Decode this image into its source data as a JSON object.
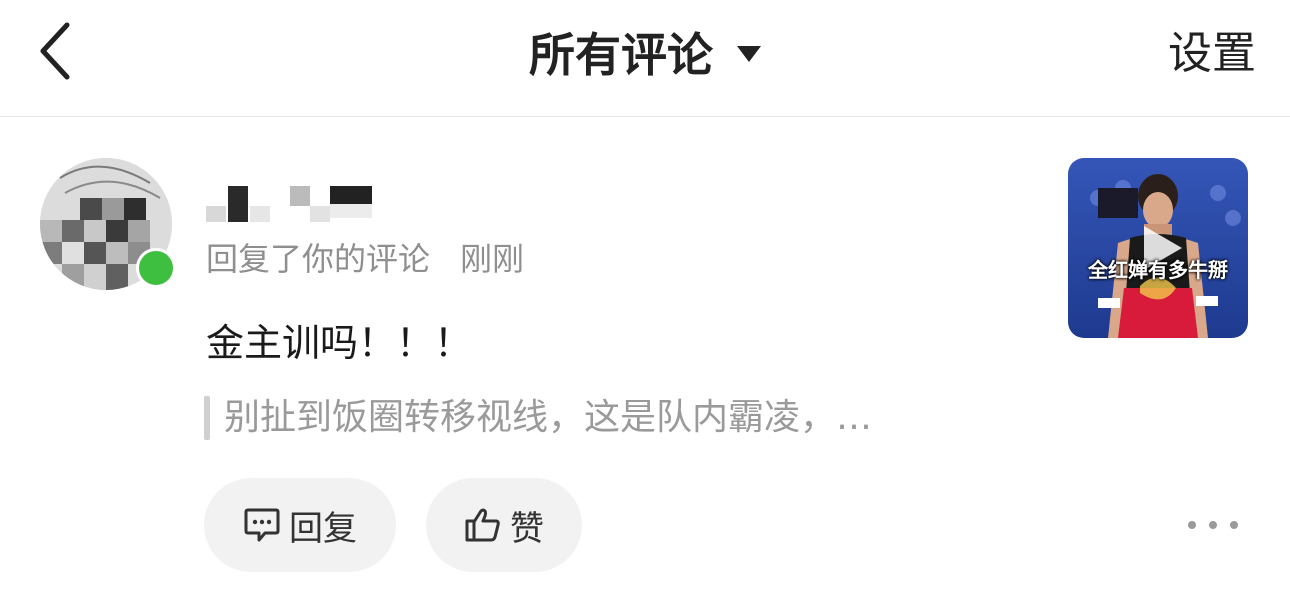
{
  "header": {
    "title": "所有评论",
    "settings_label": "设置"
  },
  "comment": {
    "action_text": "回复了你的评论",
    "time": "刚刚",
    "text": "金主训吗！！！",
    "quoted_text": "别扯到饭圈转移视线，这是队内霸凌，…",
    "thumbnail_caption": "全红婵有多牛掰",
    "reply_label": "回复",
    "like_label": "赞"
  },
  "colors": {
    "accent_green": "#3fbf3f",
    "muted_text": "#8f8f8f",
    "button_bg": "#f2f2f2"
  },
  "icons": {
    "back": "chevron-left-icon",
    "caret": "caret-down-icon",
    "reply": "comment-bubble-icon",
    "like": "thumbs-up-icon",
    "more": "more-dots-icon",
    "play": "play-icon"
  }
}
